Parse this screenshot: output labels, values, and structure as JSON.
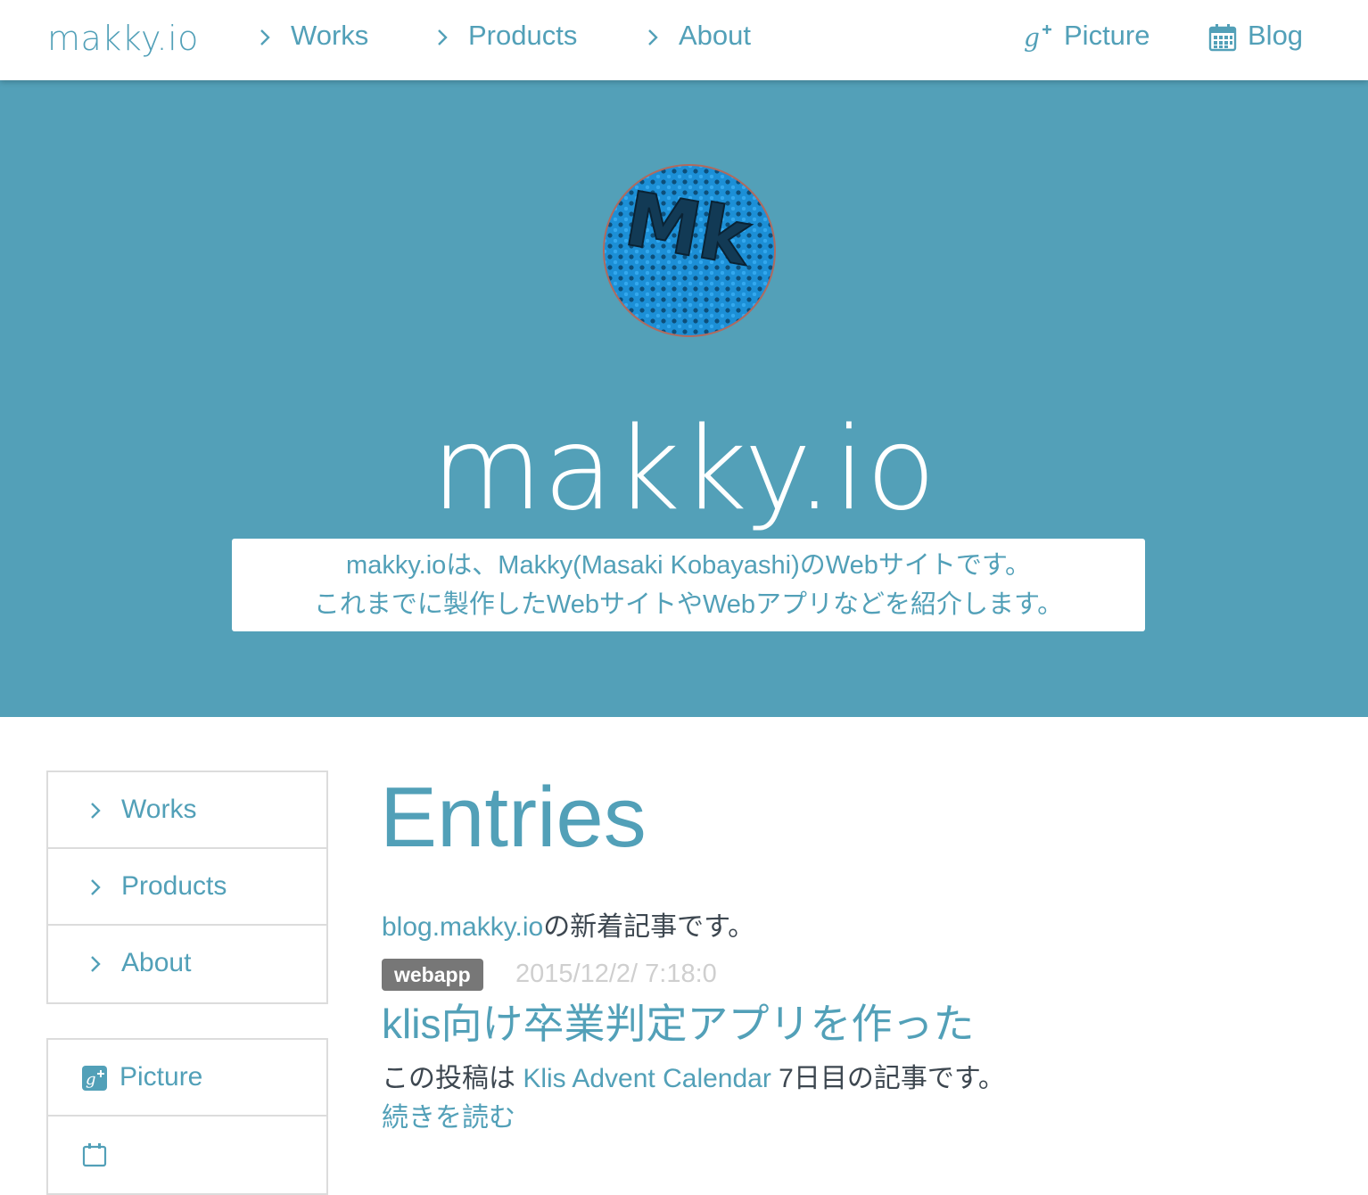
{
  "navbar": {
    "brand": "makky.io",
    "links": [
      {
        "label": "Works",
        "icon": "chevron-right-icon"
      },
      {
        "label": "Products",
        "icon": "chevron-right-icon"
      },
      {
        "label": "About",
        "icon": "chevron-right-icon"
      }
    ],
    "right_links": [
      {
        "label": "Picture",
        "icon": "google-plus-icon"
      },
      {
        "label": "Blog",
        "icon": "calendar-icon"
      }
    ]
  },
  "hero": {
    "avatar_text": "Mk",
    "title": "makky.io",
    "description_line1": "makky.ioは、Makky(Masaki Kobayashi)のWebサイトです。",
    "description_line2": "これまでに製作したWebサイトやWebアプリなどを紹介します。"
  },
  "sidebar": {
    "nav_items": [
      {
        "label": "Works",
        "icon": "chevron-right-icon"
      },
      {
        "label": "Products",
        "icon": "chevron-right-icon"
      },
      {
        "label": "About",
        "icon": "chevron-right-icon"
      }
    ],
    "ext_items": [
      {
        "label": "Picture",
        "icon": "google-plus-square-icon"
      },
      {
        "label": "",
        "icon": "calendar-icon"
      }
    ]
  },
  "main": {
    "heading": "Entries",
    "intro_link": "blog.makky.io",
    "intro_text": "の新着記事です。",
    "entry": {
      "tag": "webapp",
      "date": "2015/12/2/ 7:18:0",
      "title": "klis向け卒業判定アプリを作った",
      "excerpt_before": "この投稿は ",
      "excerpt_link": "Klis Advent Calendar",
      "excerpt_after": " 7日目の記事です。",
      "read_more": "続きを読む"
    }
  },
  "colors": {
    "accent": "#52a0b8",
    "hero_bg": "#53a0b8",
    "text": "#3d4750",
    "tag_bg": "#777777",
    "date": "#cfcfcf",
    "border": "#dcdcdc"
  }
}
